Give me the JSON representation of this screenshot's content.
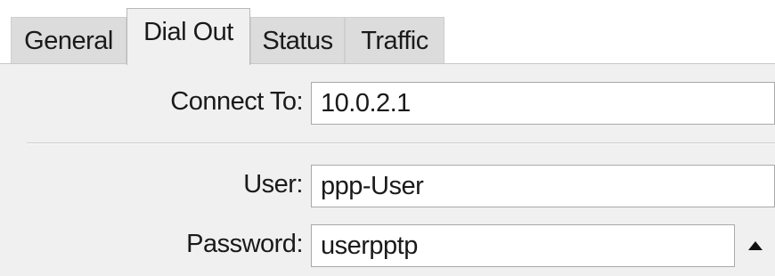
{
  "tabs": [
    {
      "label": "General",
      "active": false
    },
    {
      "label": "Dial Out",
      "active": true
    },
    {
      "label": "Status",
      "active": false
    },
    {
      "label": "Traffic",
      "active": false
    }
  ],
  "form": {
    "connect_to": {
      "label": "Connect To:",
      "value": "10.0.2.1"
    },
    "user": {
      "label": "User:",
      "value": "ppp-User"
    },
    "password": {
      "label": "Password:",
      "value": "userpptp",
      "toggle_icon": "triangle-up-icon"
    }
  }
}
